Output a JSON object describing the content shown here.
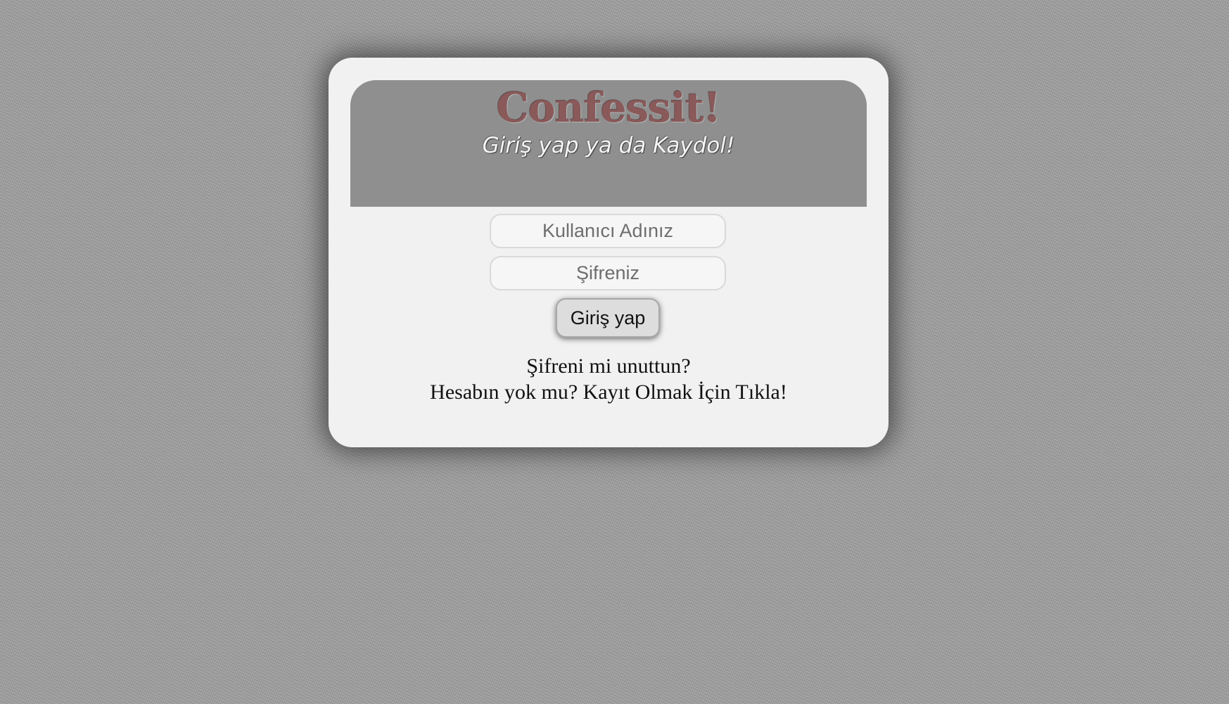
{
  "login_card": {
    "brand": "Confessit!",
    "tagline": "Giriş yap ya da Kaydol!",
    "username_placeholder": "Kullanıcı Adınız",
    "password_placeholder": "Şifreniz",
    "submit_label": "Giriş yap",
    "forgot_password_link": "Şifreni mi unuttun?",
    "register_link": "Hesabın yok mu? Kayıt Olmak İçin Tıkla!"
  },
  "colors": {
    "page_background": "#9c9c9c",
    "card_background": "#f1f1f1",
    "banner_background": "#8f8f8f",
    "brand_text": "#8a5959",
    "tagline_text": "#f5f5f5"
  }
}
